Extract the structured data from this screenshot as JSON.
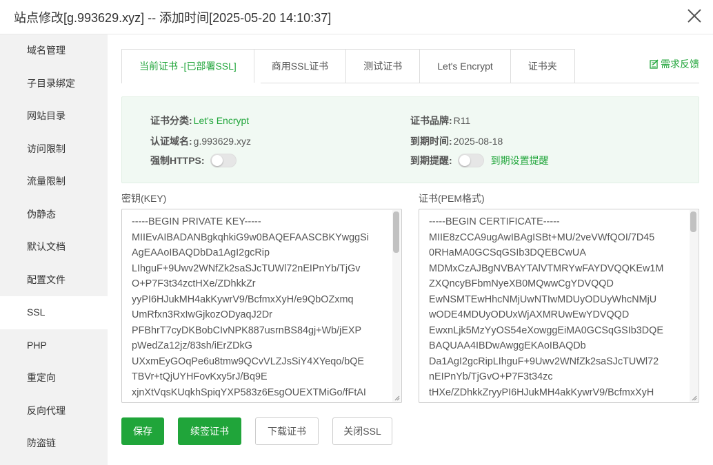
{
  "window": {
    "title": "站点修改[g.993629.xyz] -- 添加时间[2025-05-20 14:10:37]"
  },
  "sidebar": {
    "items": [
      {
        "label": "域名管理"
      },
      {
        "label": "子目录绑定"
      },
      {
        "label": "网站目录"
      },
      {
        "label": "访问限制"
      },
      {
        "label": "流量限制"
      },
      {
        "label": "伪静态"
      },
      {
        "label": "默认文档"
      },
      {
        "label": "配置文件"
      },
      {
        "label": "SSL"
      },
      {
        "label": "PHP"
      },
      {
        "label": "重定向"
      },
      {
        "label": "反向代理"
      },
      {
        "label": "防盗链"
      }
    ],
    "active_index": 8
  },
  "tabs": [
    {
      "label": "当前证书 -[已部署SSL]"
    },
    {
      "label": "商用SSL证书"
    },
    {
      "label": "测试证书"
    },
    {
      "label": "Let's Encrypt"
    },
    {
      "label": "证书夹"
    }
  ],
  "feedback_label": "需求反馈",
  "cert_info": {
    "category_label": "证书分类:",
    "category_value": "Let's Encrypt",
    "brand_label": "证书品牌:",
    "brand_value": "R11",
    "domain_label": "认证域名:",
    "domain_value": "g.993629.xyz",
    "expire_label": "到期时间:",
    "expire_value": "2025-08-18",
    "https_label": "强制HTTPS:",
    "https_enabled": false,
    "remind_label": "到期提醒:",
    "remind_enabled": false,
    "remind_link": "到期设置提醒"
  },
  "key_pane": {
    "label": "密钥(KEY)",
    "lines": [
      "-----BEGIN PRIVATE KEY-----",
      "MIIEvAIBADANBgkqhkiG9w0BAQEFAASCBKYwggSi",
      "AgEAAoIBAQDbDa1AgI2gcRip",
      "LIhguF+9Uwv2WNfZk2saSJcTUWl72nEIPnYb/TjGv",
      "O+P7F3t34zctHXe/ZDhkkZr",
      "yyPI6HJukMH4akKywrV9/BcfmxXyH/e9QbOZxmq",
      "UmRfxn3RxIwGjkozODyaqJ2Dr",
      "PFBhrT7cyDKBobCIvNPK887usrnBS84gj+Wb/jEXP",
      "pWedZa12jz/83sh/iErZDkG",
      "UXxmEyGOqPe6u8tmw9QCvVLZJsSiY4XYeqo/bQE",
      "TBVr+tQjUYHFovKxy5rJ/Bq9E",
      "xjnXtVqsKUqkhSpiqYXP583z6EsgOUEXTMiGo/fFtAI"
    ]
  },
  "cert_pane": {
    "label": "证书(PEM格式)",
    "lines": [
      "-----BEGIN CERTIFICATE-----",
      "MIIE8zCCA9ugAwIBAgISBt+MU/2veVWfQOI/7D45",
      "0RHaMA0GCSqGSIb3DQEBCwUA",
      "MDMxCzAJBgNVBAYTAlVTMRYwFAYDVQQKEw1M",
      "ZXQncyBFbmNyeXB0MQwwCgYDVQQD",
      "EwNSMTEwHhcNMjUwNTIwMDUyODUyWhcNMjU",
      "wODE4MDUyODUxWjAXMRUwEwYDVQQD",
      "EwxnLjk5MzYyOS54eXowggEiMA0GCSqGSIb3DQE",
      "BAQUAA4IBDwAwggEKAoIBAQDb",
      "Da1AgI2gcRipLIhguF+9Uwv2WNfZk2saSJcTUWl72",
      "nEIPnYb/TjGvO+P7F3t34zc",
      "tHXe/ZDhkkZryyPI6HJukMH4akKywrV9/BcfmxXyH"
    ]
  },
  "buttons": {
    "save": "保存",
    "renew": "续签证书",
    "download": "下载证书",
    "close_ssl": "关闭SSL"
  }
}
